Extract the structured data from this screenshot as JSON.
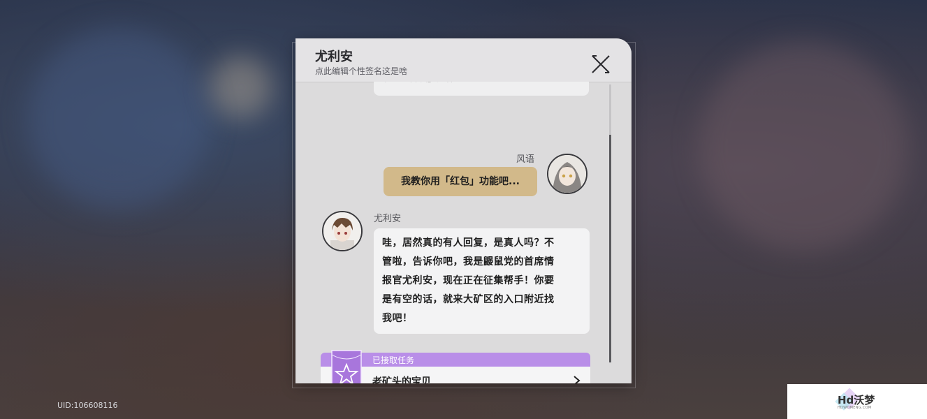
{
  "header": {
    "contact_name": "尤利安",
    "signature": "点此编辑个性签名这是啥"
  },
  "messages": {
    "partial_text": "啊…「群友」是什么意思？",
    "outgoing_sender": "风语",
    "outgoing_text": "我教你用「红包」功能吧...",
    "incoming_sender": "尤利安",
    "incoming_lines": [
      "哇，居然真的有人回复，是真人吗？不",
      "管啦，告诉你吧，我是鼹鼠党的首席情",
      "报官尤利安，现在正在征集帮手！你要",
      "是有空的话，就来大矿区的入口附近找",
      "我吧！"
    ]
  },
  "quest": {
    "status": "已接取任务",
    "title": "老矿头的宝贝"
  },
  "footer": {
    "uid": "UID:106608116"
  },
  "watermark": {
    "brand": "Hd沃梦",
    "sub": "HDWOMENG.COM"
  },
  "colors": {
    "panel": "#dcdbdc",
    "outgoing_bubble": "#d2b98a",
    "quest_accent": "#b98ee8"
  },
  "icons": {
    "close": "close-icon",
    "arrow": "chevron-right-icon",
    "quest_badge": "star-badge-icon"
  }
}
